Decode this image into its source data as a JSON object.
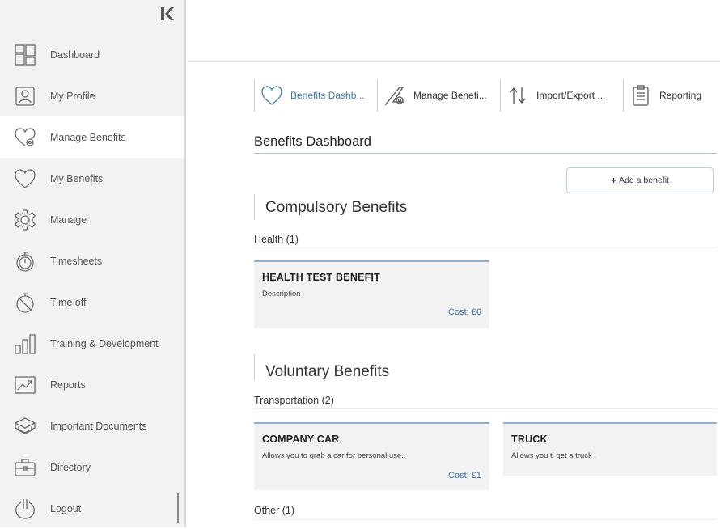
{
  "sidebar": {
    "items": [
      {
        "label": "Dashboard",
        "icon": "dashboard-icon"
      },
      {
        "label": "My Profile",
        "icon": "profile-icon"
      },
      {
        "label": "Manage Benefits",
        "icon": "manage-benefits-icon"
      },
      {
        "label": "My Benefits",
        "icon": "heart-icon"
      },
      {
        "label": "Manage",
        "icon": "gear-icon"
      },
      {
        "label": "Timesheets",
        "icon": "stopwatch-icon"
      },
      {
        "label": "Time off",
        "icon": "stopwatch-off-icon"
      },
      {
        "label": "Training & Development",
        "icon": "bar-chart-icon"
      },
      {
        "label": "Reports",
        "icon": "reports-icon"
      },
      {
        "label": "Important Documents",
        "icon": "documents-icon"
      },
      {
        "label": "Directory",
        "icon": "briefcase-icon"
      },
      {
        "label": "Logout",
        "icon": "power-icon"
      }
    ],
    "active_index": 2
  },
  "tabs": [
    {
      "label": "Benefits Dashb...",
      "icon": "heart-icon"
    },
    {
      "label": "Manage Benefi...",
      "icon": "manage-benefits-icon"
    },
    {
      "label": "Import/Export ...",
      "icon": "import-export-icon"
    },
    {
      "label": "Reporting",
      "icon": "clipboard-icon"
    }
  ],
  "page": {
    "title": "Benefits Dashboard",
    "add_button_label": "Add a benefit"
  },
  "sections": {
    "compulsory": {
      "title": "Compulsory Benefits",
      "groups": {
        "health": {
          "label": "Health (1)",
          "cards": [
            {
              "title": "HEALTH TEST BENEFIT",
              "description": "Description",
              "cost": "Cost: £6"
            }
          ]
        }
      }
    },
    "voluntary": {
      "title": "Voluntary Benefits",
      "groups": {
        "transportation": {
          "label": "Transportation (2)",
          "cards": [
            {
              "title": "COMPANY CAR",
              "description": "Allows you to grab a car for personal use.",
              "cost": "Cost: £1"
            },
            {
              "title": "TRUCK",
              "description": "Allows you ti get a truck .",
              "cost": ""
            }
          ]
        },
        "other": {
          "label": "Other (1)"
        }
      }
    }
  },
  "colors": {
    "accent": "#3b78b8",
    "sidebar_bg": "#f2f2f2",
    "card_bg": "#f2f2f2",
    "card_top_border": "#8fb2d3"
  }
}
